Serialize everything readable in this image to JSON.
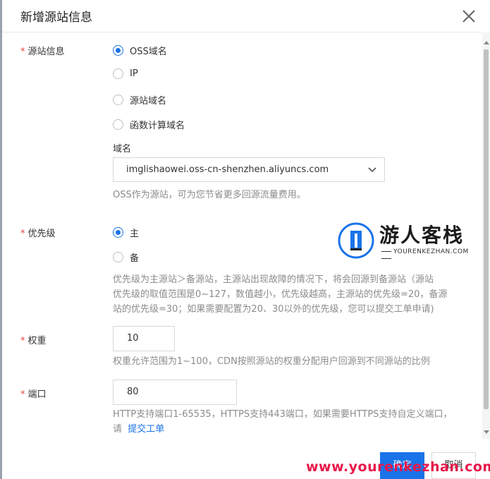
{
  "dialog": {
    "title": "新增源站信息"
  },
  "origin": {
    "label": "源站信息",
    "options": [
      "OSS域名",
      "IP",
      "源站域名",
      "函数计算域名"
    ],
    "selected_index": 0,
    "domain_label": "域名",
    "domain_value": "imglishaowei.oss-cn-shenzhen.aliyuncs.com",
    "hint": "OSS作为源站，可为您节省更多回源流量费用。"
  },
  "priority": {
    "label": "优先级",
    "options": [
      "主",
      "备"
    ],
    "selected_index": 0,
    "hint_lines": [
      "优先级为主源站＞备源站，主源站出现故障的情况下，将会回源到备源站（源站",
      "优先级的取值范围是0~127，数值越小，优先级越高，主源站的优先级=20，备源",
      "站的优先级=30；如果需要配置为20、30以外的优先级，您可以提交工单申请)"
    ]
  },
  "weight": {
    "label": "权重",
    "value": "10",
    "hint": "权重允许范围为1~100，CDN按照源站的权重分配用户回源到不同源站的比例"
  },
  "port": {
    "label": "端口",
    "value": "80",
    "hint_line1": "HTTP支持端口1-65535，HTTPS支持443端口，如果需要HTTPS支持自定义端口，",
    "hint_line2_prefix": "请",
    "hint_link": "提交工单"
  },
  "watermark": {
    "title": "游人客栈",
    "subtitle": "YOURENKEZHAN.COM",
    "url": "www.yourenkezhan.com"
  },
  "footer": {
    "ok_label": "确定",
    "cancel_label": "取消"
  },
  "colors": {
    "accent": "#1a73e8",
    "required_star": "#e64340",
    "watermark_red": "#e8174a"
  }
}
